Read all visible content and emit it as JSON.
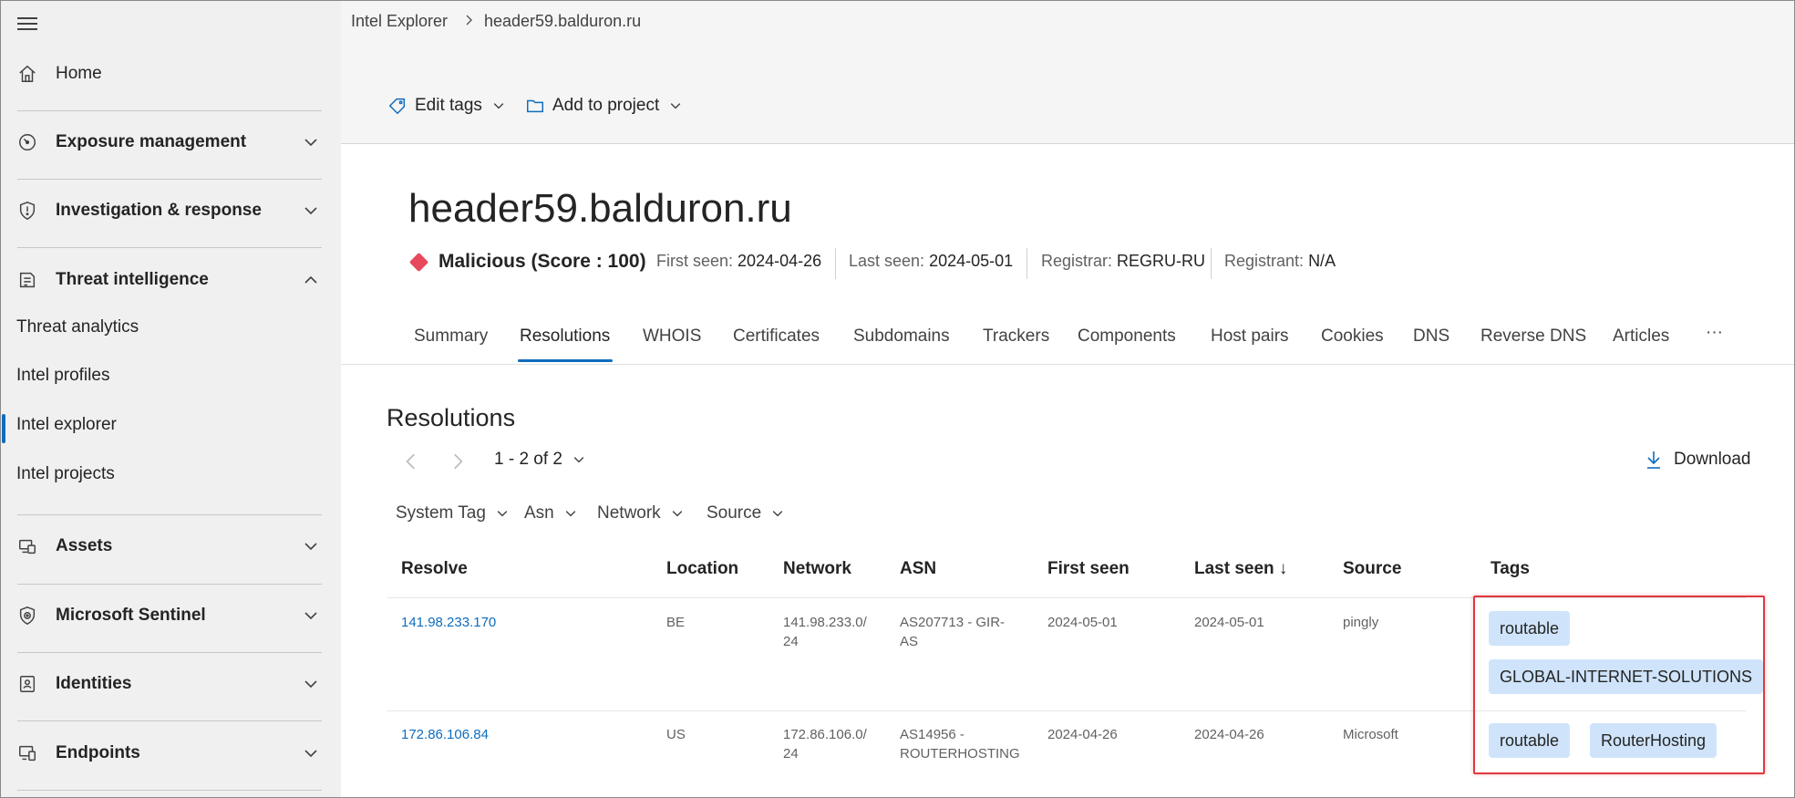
{
  "sidebar": {
    "home": "Home",
    "exposure": "Exposure management",
    "investigation": "Investigation & response",
    "threat_intel": "Threat intelligence",
    "threat_analytics": "Threat analytics",
    "intel_profiles": "Intel profiles",
    "intel_explorer": "Intel explorer",
    "intel_projects": "Intel projects",
    "assets": "Assets",
    "sentinel": "Microsoft Sentinel",
    "identities": "Identities",
    "endpoints": "Endpoints"
  },
  "breadcrumb": {
    "root": "Intel Explorer",
    "current": "header59.balduron.ru"
  },
  "toolbar": {
    "edit_tags": "Edit tags",
    "add_to_project": "Add to project"
  },
  "entity": {
    "title": "header59.balduron.ru",
    "reputation": "Malicious (Score : 100)",
    "first_seen_label": "First seen:",
    "first_seen": "2024-04-26",
    "last_seen_label": "Last seen:",
    "last_seen": "2024-05-01",
    "registrar_label": "Registrar:",
    "registrar": "REGRU-RU",
    "registrant_label": "Registrant:",
    "registrant": "N/A"
  },
  "tabs": [
    "Summary",
    "Resolutions",
    "WHOIS",
    "Certificates",
    "Subdomains",
    "Trackers",
    "Components",
    "Host pairs",
    "Cookies",
    "DNS",
    "Reverse DNS",
    "Articles",
    "···"
  ],
  "resolutions": {
    "title": "Resolutions",
    "pager": "1 - 2 of 2",
    "download": "Download",
    "filters": [
      "System Tag",
      "Asn",
      "Network",
      "Source"
    ],
    "columns": [
      "Resolve",
      "Location",
      "Network",
      "ASN",
      "First seen",
      "Last seen ↓",
      "Source",
      "Tags"
    ],
    "rows": [
      {
        "resolve": "141.98.233.170",
        "location": "BE",
        "network_l1": "141.98.233.0/",
        "network_l2": "24",
        "asn_l1": "AS207713 - GIR-",
        "asn_l2": "AS",
        "first_seen": "2024-05-01",
        "last_seen": "2024-05-01",
        "source": "pingly",
        "tags": [
          "routable",
          "GLOBAL-INTERNET-SOLUTIONS"
        ]
      },
      {
        "resolve": "172.86.106.84",
        "location": "US",
        "network_l1": "172.86.106.0/",
        "network_l2": "24",
        "asn_l1": "AS14956 -",
        "asn_l2": "ROUTERHOSTING",
        "first_seen": "2024-04-26",
        "last_seen": "2024-04-26",
        "source": "Microsoft",
        "tags": [
          "routable",
          "RouterHosting"
        ]
      }
    ]
  },
  "colors": {
    "accent": "#0f6cbd",
    "malicious": "#e8485c",
    "tag_bg": "#cfe4fa",
    "highlight": "#e0393e"
  }
}
